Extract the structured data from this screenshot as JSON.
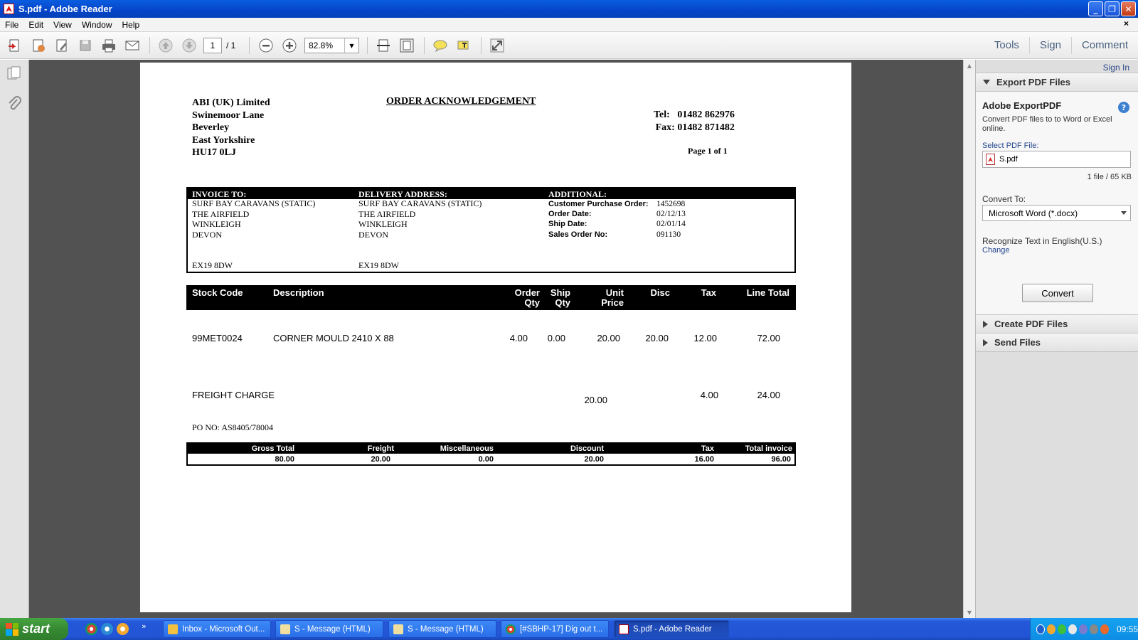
{
  "window": {
    "title": "S.pdf - Adobe Reader",
    "close_doc": "×"
  },
  "menu": [
    "File",
    "Edit",
    "View",
    "Window",
    "Help"
  ],
  "toolbar": {
    "page_current": "1",
    "page_total": "/ 1",
    "zoom": "82.8%",
    "links": [
      "Tools",
      "Sign",
      "Comment"
    ]
  },
  "doc": {
    "company": [
      "ABI (UK) Limited",
      "Swinemoor Lane",
      "Beverley",
      "East Yorkshire",
      "HU17 0LJ"
    ],
    "title": "ORDER ACKNOWLEDGEMENT",
    "tel_label": "Tel:",
    "tel": "01482 862976",
    "fax_label": "Fax:",
    "fax": "01482 871482",
    "page_of": "Page 1 of 1",
    "invoice_hdr": "INVOICE TO:",
    "delivery_hdr": "DELIVERY ADDRESS:",
    "additional_hdr": "ADDITIONAL:",
    "invoice_to": [
      "SURF BAY CARAVANS (STATIC)",
      "THE AIRFIELD",
      "WINKLEIGH",
      "DEVON"
    ],
    "invoice_postcode": "EX19 8DW",
    "delivery_to": [
      "SURF BAY CARAVANS (STATIC)",
      "THE AIRFIELD",
      "WINKLEIGH",
      "DEVON"
    ],
    "delivery_postcode": "EX19 8DW",
    "additional": [
      {
        "label": "Customer Purchase Order:",
        "value": "1452698"
      },
      {
        "label": "Order Date:",
        "value": "02/12/13"
      },
      {
        "label": "Ship Date:",
        "value": "02/01/14"
      },
      {
        "label": "Sales Order No:",
        "value": "091130"
      }
    ],
    "columns": {
      "stock_code": "Stock Code",
      "description": "Description",
      "order_qty": [
        "Order",
        "Qty"
      ],
      "ship_qty": [
        "Ship",
        "Qty"
      ],
      "unit_price": [
        "Unit",
        "Price"
      ],
      "disc": "Disc",
      "tax": "Tax",
      "line_total": "Line Total"
    },
    "item": {
      "code": "99MET0024",
      "desc": "CORNER MOULD 2410 X 88",
      "order_qty": "4.00",
      "ship_qty": "0.00",
      "unit_price": "20.00",
      "disc": "20.00",
      "tax": "12.00",
      "total": "72.00"
    },
    "freight": {
      "desc": "FREIGHT CHARGE",
      "unit_price": "20.00",
      "tax": "4.00",
      "total": "24.00"
    },
    "po_no": "PO NO: AS8405/78004",
    "totals": {
      "labels": [
        "Gross Total",
        "Freight",
        "Miscellaneous",
        "Discount",
        "Tax",
        "Total invoice"
      ],
      "values": [
        "80.00",
        "20.00",
        "0.00",
        "20.00",
        "16.00",
        "96.00"
      ]
    }
  },
  "rightpanel": {
    "sign_in": "Sign In",
    "export_hdr": "Export PDF Files",
    "export_title": "Adobe ExportPDF",
    "export_desc1": "Convert PDF files to to Word or Excel",
    "export_desc2": "online.",
    "select_label": "Select PDF File:",
    "file_name": "S.pdf",
    "file_info": "1 file / 65 KB",
    "convert_to_label": "Convert To:",
    "convert_to_value": "Microsoft Word (*.docx)",
    "recognize": "Recognize Text in English(U.S.)",
    "change": "Change",
    "convert_btn": "Convert",
    "create_hdr": "Create PDF Files",
    "send_hdr": "Send Files"
  },
  "taskbar": {
    "start": "start",
    "tasks": [
      "Inbox - Microsoft Out...",
      "S - Message (HTML)",
      "S - Message (HTML)",
      "[#SBHP-17] Dig out t...",
      "S.pdf - Adobe Reader"
    ],
    "clock": "09:55"
  },
  "colors": {
    "title_bar": "#0544c8",
    "doc_bg": "#525252",
    "taskbar": "#2458d8",
    "start": "#368a32",
    "link_blue": "#23448c"
  }
}
